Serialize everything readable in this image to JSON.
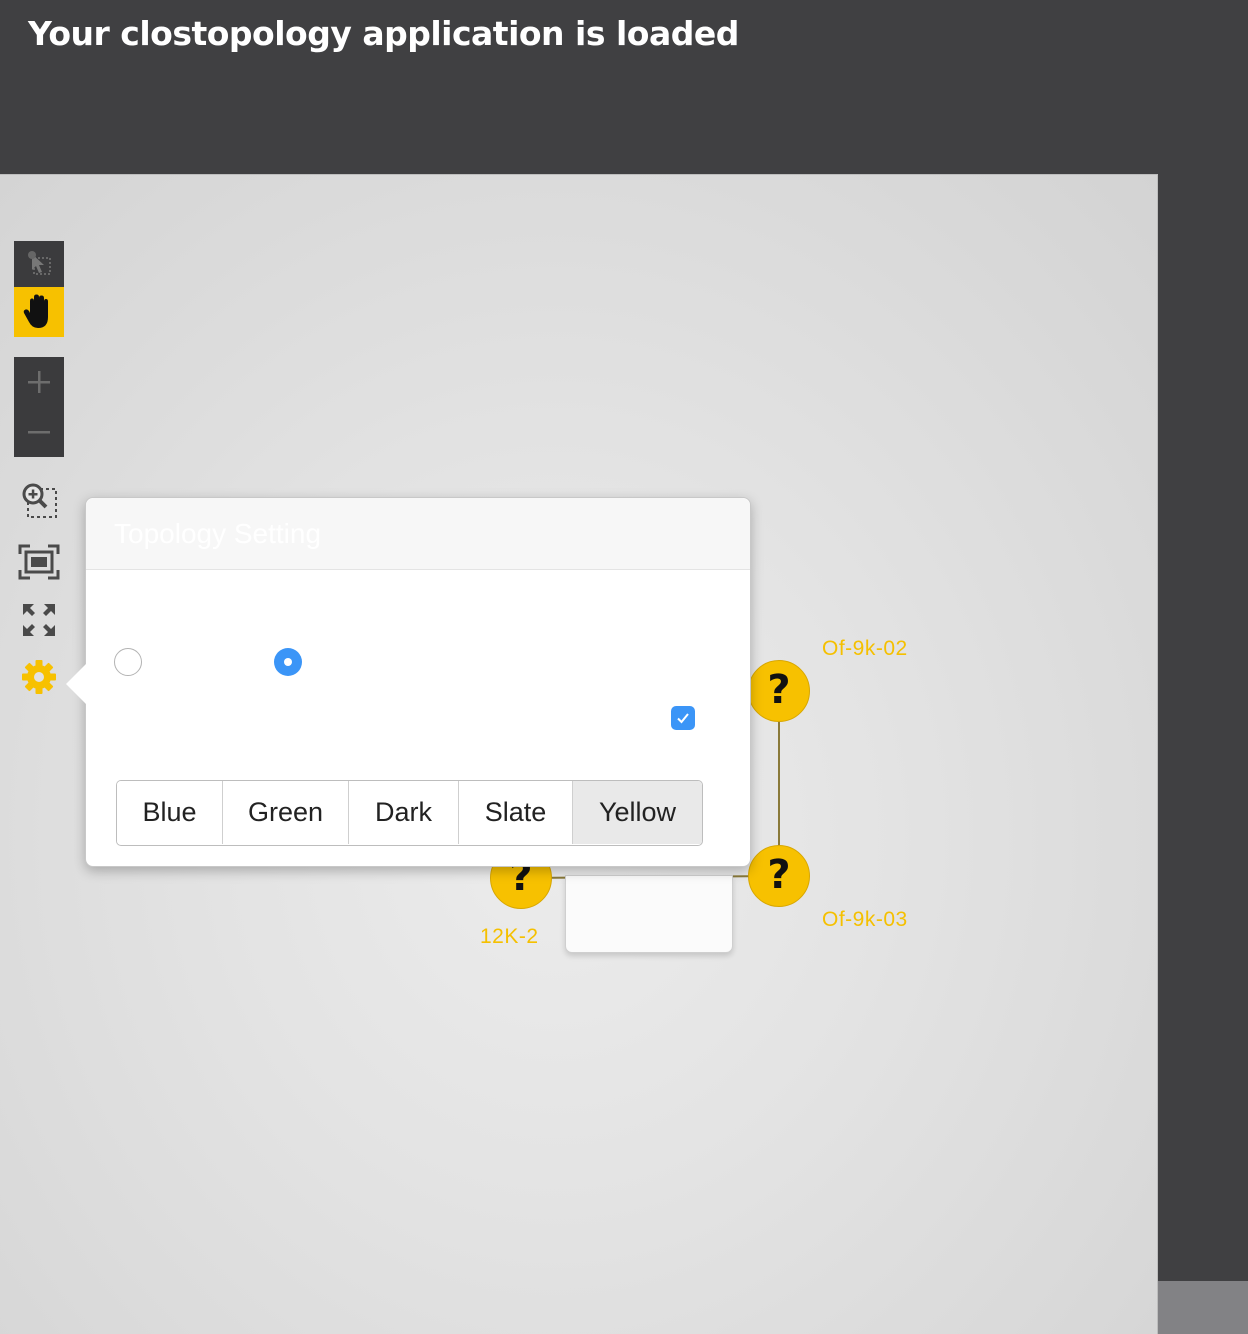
{
  "page": {
    "title": "Your clostopology application is loaded"
  },
  "toolbar": {
    "tools": [
      {
        "name": "select-mode",
        "icon": "select-pointer-icon",
        "active": false
      },
      {
        "name": "pan-mode",
        "icon": "hand-icon",
        "active": true
      },
      {
        "name": "zoom-in",
        "icon": "plus-icon"
      },
      {
        "name": "zoom-out",
        "icon": "minus-icon"
      },
      {
        "name": "zoom-by-selection",
        "icon": "zoom-select-icon"
      },
      {
        "name": "fit-to-stage",
        "icon": "fit-stage-icon"
      },
      {
        "name": "fullscreen",
        "icon": "fullscreen-icon"
      },
      {
        "name": "settings",
        "icon": "gear-icon"
      }
    ]
  },
  "popover": {
    "title": "Topology Setting",
    "radio_options": [
      {
        "selected": false
      },
      {
        "selected": true
      }
    ],
    "checkbox_checked": true,
    "themes": [
      "Blue",
      "Green",
      "Dark",
      "Slate",
      "Yellow"
    ],
    "selected_theme": "Yellow"
  },
  "topology": {
    "nodes": [
      {
        "label": "Of-9k-02",
        "glyph": "?"
      },
      {
        "label": "Of-9k-03",
        "glyph": "?"
      },
      {
        "label": "12K-2",
        "glyph": "?"
      }
    ]
  },
  "colors": {
    "accent": "#f7c100",
    "header_bg": "#404042",
    "control_blue": "#3b95f7",
    "link": "#8a7a3a"
  }
}
